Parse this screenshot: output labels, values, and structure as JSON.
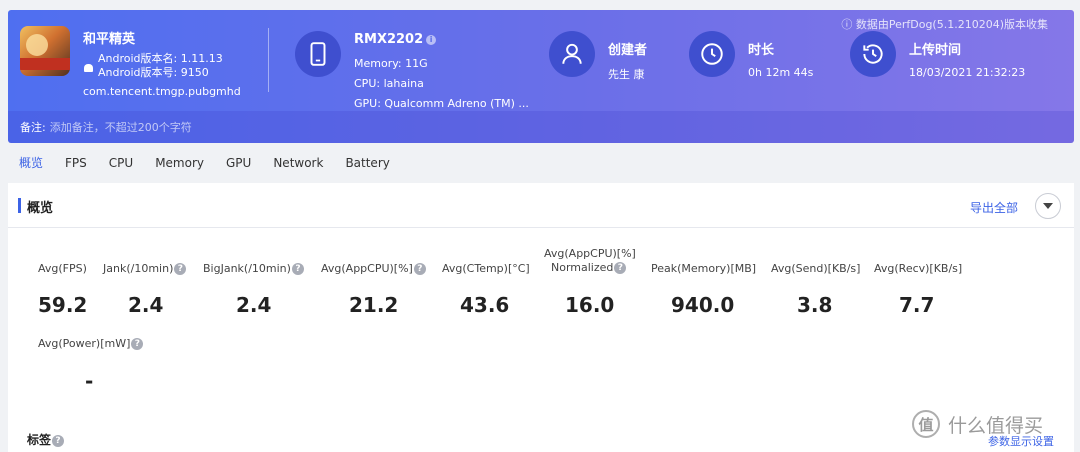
{
  "header": {
    "collect_note": "数据由PerfDog(5.1.210204)版本收集",
    "app": {
      "name": "和平精英",
      "version_name": "Android版本名: 1.11.13",
      "version_code": "Android版本号: 9150",
      "package": "com.tencent.tmgp.pubgmhd"
    },
    "device": {
      "model": "RMX2202",
      "memory": "Memory: 11G",
      "cpu": "CPU: lahaina",
      "gpu": "GPU: Qualcomm Adreno (TM) ..."
    },
    "creator": {
      "label": "创建者",
      "value": "先生 康"
    },
    "duration": {
      "label": "时长",
      "value": "0h 12m 44s"
    },
    "upload": {
      "label": "上传时间",
      "value": "18/03/2021 21:32:23"
    },
    "note": {
      "label": "备注:",
      "placeholder": "添加备注，不超过200个字符"
    }
  },
  "tabs": [
    "概览",
    "FPS",
    "CPU",
    "Memory",
    "GPU",
    "Network",
    "Battery"
  ],
  "overview": {
    "title": "概览",
    "export_label": "导出全部",
    "metrics": [
      {
        "label": "Avg(FPS)",
        "value": "59.2",
        "help": false
      },
      {
        "label": "Jank(/10min)",
        "value": "2.4",
        "help": true
      },
      {
        "label": "BigJank(/10min)",
        "value": "2.4",
        "help": true
      },
      {
        "label": "Avg(AppCPU)[%]",
        "value": "21.2",
        "help": true
      },
      {
        "label": "Avg(CTemp)[°C]",
        "value": "43.6",
        "help": false
      },
      {
        "label_line1": "Avg(AppCPU)[%]",
        "label_line2": "Normalized",
        "value": "16.0",
        "help": true
      },
      {
        "label": "Peak(Memory)[MB]",
        "value": "940.0",
        "help": false
      },
      {
        "label": "Avg(Send)[KB/s]",
        "value": "3.8",
        "help": false
      },
      {
        "label": "Avg(Recv)[KB/s]",
        "value": "7.7",
        "help": false
      },
      {
        "label": "Avg(Power)[mW]",
        "value": "-",
        "help": true
      }
    ],
    "tags_label": "标签",
    "param_link": "参数显示设置"
  },
  "watermark": {
    "logo": "值",
    "text": "什么值得买"
  },
  "colors": {
    "accent": "#3c63e6",
    "banner_start": "#4f6ff0",
    "banner_end": "#8577e8",
    "icon_circle": "#3f4fcf"
  }
}
